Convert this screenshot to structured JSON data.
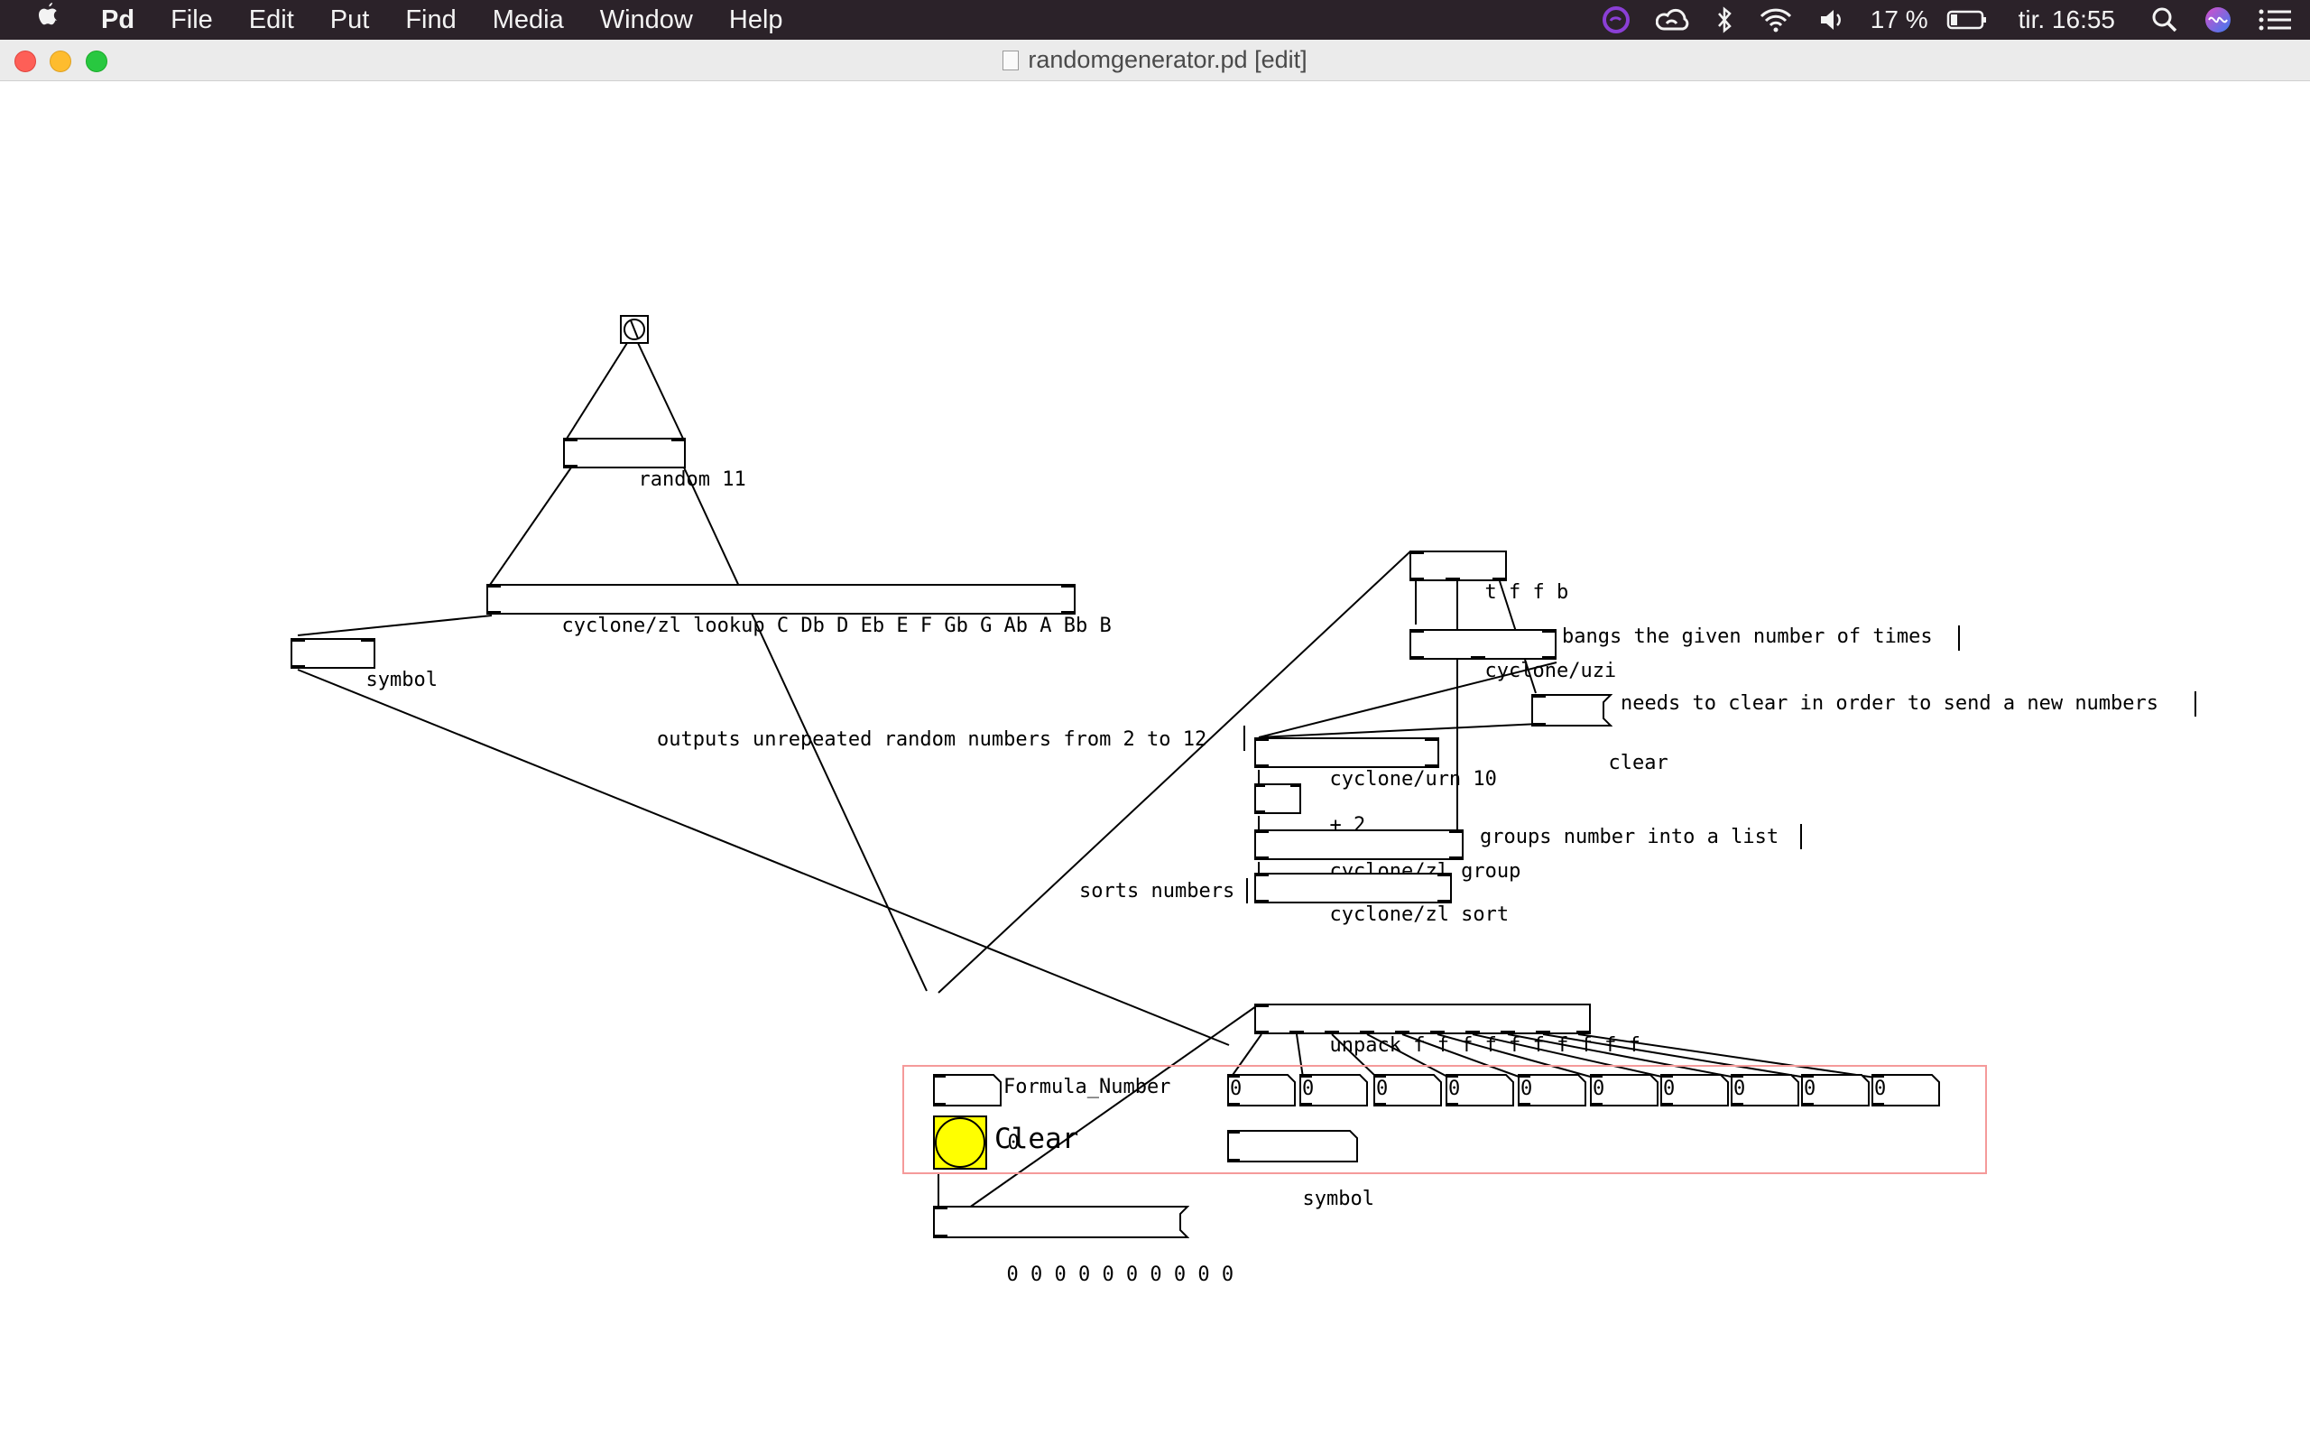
{
  "menubar": {
    "apple": "",
    "app_name": "Pd",
    "items": [
      "File",
      "Edit",
      "Put",
      "Find",
      "Media",
      "Window",
      "Help"
    ],
    "battery": "17 %",
    "clock": "tir. 16:55"
  },
  "window": {
    "title": "randomgenerator.pd [edit]"
  },
  "patch": {
    "random": "random 11",
    "lookup": "cyclone/zl lookup C Db D Eb E F Gb G Ab A Bb B",
    "symbol_left": "symbol",
    "t_ffb": "t f f b",
    "uzi": "cyclone/uzi",
    "comment_uzi": "bangs the given number of times",
    "clear_msg": "clear",
    "comment_clear": "needs to clear in order to send a new numbers",
    "comment_urn": "outputs unrepeated random numbers from 2 to 12",
    "urn": "cyclone/urn 10",
    "plus2": "+ 2",
    "group": "cyclone/zl group",
    "comment_group": "groups number into a list",
    "comment_sort": "sorts numbers",
    "sort": "cyclone/zl sort",
    "unpack": "unpack f f f f f f f f f f",
    "formula_number_value": "0",
    "formula_number_label": "Formula_Number",
    "clear_bang_label": "Clear",
    "numbox_values": [
      "0",
      "0",
      "0",
      "0",
      "0",
      "0",
      "0",
      "0",
      "0",
      "0"
    ],
    "symbol_gop": "symbol",
    "list_msg": "0 0 0 0 0 0 0 0 0 0"
  },
  "colors": {
    "bang_fill": "#ffff00",
    "gop_border": "#f59a9a"
  }
}
